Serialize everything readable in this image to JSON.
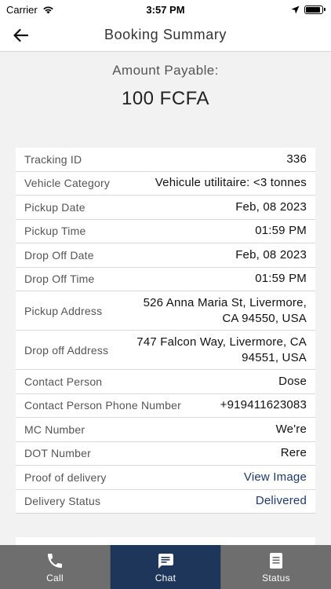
{
  "status_bar": {
    "carrier": "Carrier",
    "time": "3:57 PM",
    "battery_level": 0.9
  },
  "header": {
    "title": "Booking Summary"
  },
  "amount": {
    "label": "Amount Payable:",
    "value": "100 FCFA"
  },
  "details": [
    {
      "label": "Tracking ID",
      "value": "336"
    },
    {
      "label": "Vehicle Category",
      "value": "Vehicule utilitaire: <3 tonnes"
    },
    {
      "label": "Pickup Date",
      "value": "Feb, 08 2023"
    },
    {
      "label": "Pickup Time",
      "value": "01:59 PM"
    },
    {
      "label": "Drop Off Date",
      "value": "Feb, 08 2023"
    },
    {
      "label": "Drop Off Time",
      "value": "01:59 PM"
    },
    {
      "label": "Pickup Address",
      "value": "526 Anna Maria St, Livermore, CA 94550, USA"
    },
    {
      "label": "Drop off Address",
      "value": "747 Falcon Way, Livermore, CA 94551, USA"
    },
    {
      "label": "Contact Person",
      "value": "Dose"
    },
    {
      "label": "Contact Person Phone Number",
      "value": "+919411623083"
    },
    {
      "label": "MC Number",
      "value": "We're"
    },
    {
      "label": "DOT Number",
      "value": "Rere"
    },
    {
      "label": "Proof of delivery",
      "value": "View Image"
    },
    {
      "label": "Delivery Status",
      "value": "Delivered"
    }
  ],
  "tabs": [
    {
      "label": "Call",
      "icon": "phone-icon"
    },
    {
      "label": "Chat",
      "icon": "chat-icon"
    },
    {
      "label": "Status",
      "icon": "document-icon"
    }
  ],
  "colors": {
    "accent": "#1d3659",
    "tab_bar": "#6e6e6e",
    "link": "#1c3b6a"
  }
}
